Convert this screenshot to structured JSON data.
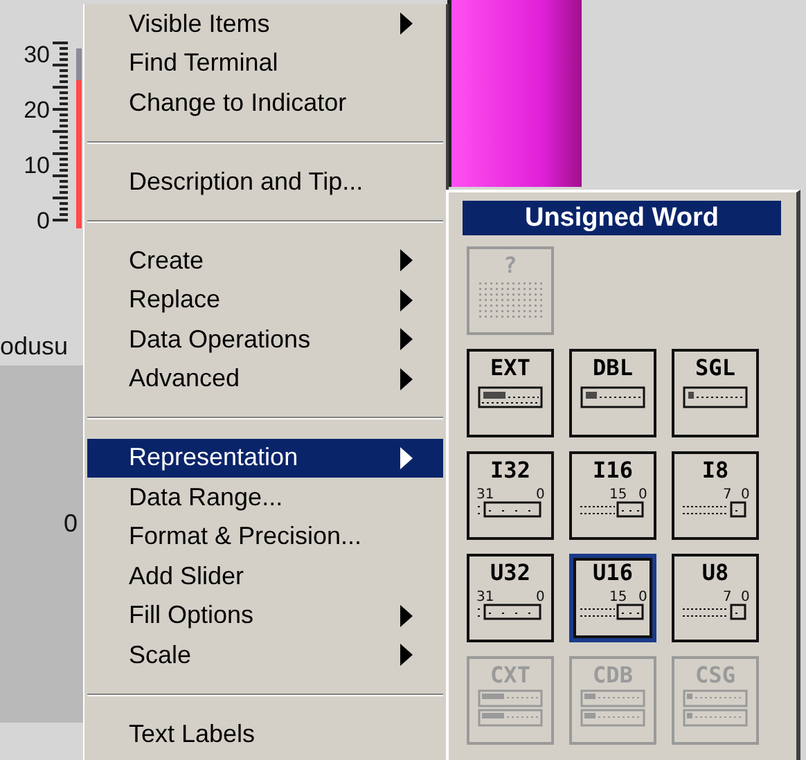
{
  "gauge": {
    "scale": [
      "30",
      "20",
      "10",
      "0"
    ],
    "level": 0.82
  },
  "label_fragment": "odusu",
  "numeric_fragment": "0",
  "context_menu": {
    "items": [
      {
        "kind": "item",
        "label": "Visible Items",
        "submenu": true,
        "selected": false
      },
      {
        "kind": "item",
        "label": "Find Terminal",
        "submenu": false,
        "selected": false
      },
      {
        "kind": "item",
        "label": "Change to Indicator",
        "submenu": false,
        "selected": false
      },
      {
        "kind": "separator"
      },
      {
        "kind": "item",
        "label": "Description and Tip...",
        "submenu": false,
        "selected": false
      },
      {
        "kind": "separator"
      },
      {
        "kind": "item",
        "label": "Create",
        "submenu": true,
        "selected": false
      },
      {
        "kind": "item",
        "label": "Replace",
        "submenu": true,
        "selected": false
      },
      {
        "kind": "item",
        "label": "Data Operations",
        "submenu": true,
        "selected": false
      },
      {
        "kind": "item",
        "label": "Advanced",
        "submenu": true,
        "selected": false
      },
      {
        "kind": "separator"
      },
      {
        "kind": "item",
        "label": "Representation",
        "submenu": true,
        "selected": true
      },
      {
        "kind": "item",
        "label": "Data Range...",
        "submenu": false,
        "selected": false
      },
      {
        "kind": "item",
        "label": "Format & Precision...",
        "submenu": false,
        "selected": false
      },
      {
        "kind": "item",
        "label": "Add Slider",
        "submenu": false,
        "selected": false
      },
      {
        "kind": "item",
        "label": "Fill Options",
        "submenu": true,
        "selected": false
      },
      {
        "kind": "item",
        "label": "Scale",
        "submenu": true,
        "selected": false
      },
      {
        "kind": "separator"
      },
      {
        "kind": "item",
        "label": "Text Labels",
        "submenu": false,
        "selected": false
      }
    ]
  },
  "representation_palette": {
    "title": "Unsigned Word",
    "options": [
      {
        "kind": "unknown",
        "label": "?",
        "disabled": true,
        "selected": false
      },
      {
        "kind": "break"
      },
      {
        "kind": "extended",
        "label": "EXT",
        "disabled": false,
        "selected": false
      },
      {
        "kind": "double",
        "label": "DBL",
        "disabled": false,
        "selected": false
      },
      {
        "kind": "single",
        "label": "SGL",
        "disabled": false,
        "selected": false
      },
      {
        "kind": "long",
        "label": "I32",
        "high_bit": "31",
        "low_bit": "0",
        "disabled": false,
        "selected": false
      },
      {
        "kind": "word",
        "label": "I16",
        "high_bit": "15",
        "low_bit": "0",
        "disabled": false,
        "selected": false
      },
      {
        "kind": "byte",
        "label": "I8",
        "high_bit": "7",
        "low_bit": "0",
        "disabled": false,
        "selected": false
      },
      {
        "kind": "long",
        "label": "U32",
        "high_bit": "31",
        "low_bit": "0",
        "disabled": false,
        "selected": false
      },
      {
        "kind": "word",
        "label": "U16",
        "high_bit": "15",
        "low_bit": "0",
        "disabled": false,
        "selected": true
      },
      {
        "kind": "byte",
        "label": "U8",
        "high_bit": "7",
        "low_bit": "0",
        "disabled": false,
        "selected": false
      },
      {
        "kind": "cextended",
        "label": "CXT",
        "disabled": true,
        "selected": false
      },
      {
        "kind": "cdouble",
        "label": "CDB",
        "disabled": true,
        "selected": false
      },
      {
        "kind": "csingle",
        "label": "CSG",
        "disabled": true,
        "selected": false
      }
    ]
  }
}
